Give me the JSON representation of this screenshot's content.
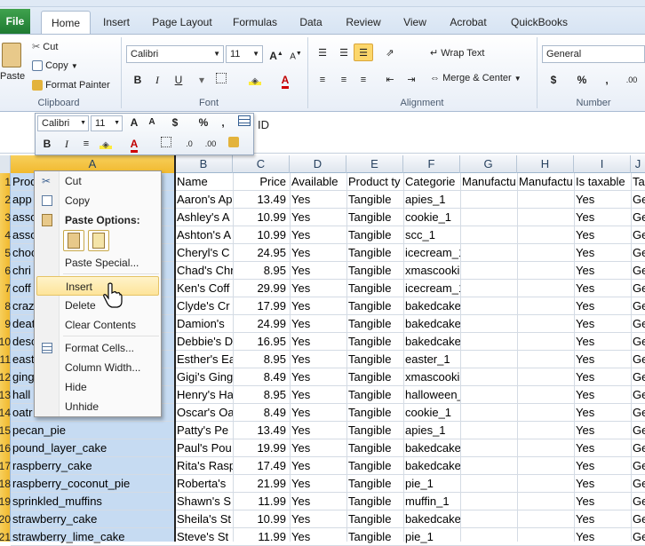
{
  "ribbon": {
    "tabs": [
      "File",
      "Home",
      "Insert",
      "Page Layout",
      "Formulas",
      "Data",
      "Review",
      "View",
      "Acrobat",
      "QuickBooks"
    ],
    "clipboard": {
      "paste": "Paste",
      "cut": "Cut",
      "copy": "Copy",
      "format_painter": "Format Painter",
      "label": "Clipboard"
    },
    "font": {
      "name": "Calibri",
      "size": "11",
      "bold": "B",
      "italic": "I",
      "underline": "U",
      "label": "Font"
    },
    "alignment": {
      "wrap_text": "Wrap Text",
      "merge_center": "Merge & Center",
      "label": "Alignment"
    },
    "number": {
      "format": "General",
      "currency": "$",
      "percent": "%",
      "label": "Number"
    }
  },
  "formula_bar": {
    "content": "ID"
  },
  "mini_toolbar": {
    "font": "Calibri",
    "size": "11",
    "currency": "$",
    "percent": "%",
    "comma": ",",
    "bold": "B",
    "italic": "I"
  },
  "context_menu": {
    "items": [
      "Cut",
      "Copy",
      "Paste Options:",
      "Paste Special...",
      "Insert",
      "Delete",
      "Clear Contents",
      "Format Cells...",
      "Column Width...",
      "Hide",
      "Unhide"
    ],
    "highlighted": "Insert"
  },
  "colors": {
    "accent": "#2a6ebb",
    "selection": "#c6dbf2",
    "row_header": "#f4c542",
    "file_tab": "#2e8b3f",
    "highlight": "#fde49a"
  },
  "columns": [
    "A",
    "B",
    "C",
    "D",
    "E",
    "F",
    "G",
    "H",
    "I",
    "J"
  ],
  "rows": [
    {
      "n": "1",
      "a": "Prod",
      "b": "Name",
      "c": "Price",
      "d": "Available",
      "e": "Product ty",
      "f": "Categorie",
      "g": "Manufactu",
      "h": "Manufactu",
      "i": "Is taxable",
      "j": "Ta"
    },
    {
      "n": "2",
      "a": "app",
      "b": "Aaron's Ap",
      "c": "13.49",
      "d": "Yes",
      "e": "Tangible",
      "f": "apies_1",
      "g": "",
      "h": "",
      "i": "Yes",
      "j": "Ge"
    },
    {
      "n": "3",
      "a": "asso",
      "b": "Ashley's A",
      "c": "10.99",
      "d": "Yes",
      "e": "Tangible",
      "f": "cookie_1",
      "g": "",
      "h": "",
      "i": "Yes",
      "j": "Ge"
    },
    {
      "n": "4",
      "a": "asso",
      "b": "Ashton's A",
      "c": "10.99",
      "d": "Yes",
      "e": "Tangible",
      "f": "scc_1",
      "g": "",
      "h": "",
      "i": "Yes",
      "j": "Ge"
    },
    {
      "n": "5",
      "a": "choc",
      "b": "Cheryl's C",
      "c": "24.95",
      "d": "Yes",
      "e": "Tangible",
      "f": "icecream_1",
      "g": "",
      "h": "",
      "i": "Yes",
      "j": "Ge"
    },
    {
      "n": "6",
      "a": "chri",
      "b": "Chad's Chr",
      "c": "8.95",
      "d": "Yes",
      "e": "Tangible",
      "f": "xmascookie_1",
      "g": "",
      "h": "",
      "i": "Yes",
      "j": "Ge"
    },
    {
      "n": "7",
      "a": "coff",
      "b": "Ken's Coff",
      "c": "29.99",
      "d": "Yes",
      "e": "Tangible",
      "f": "icecream_1",
      "g": "",
      "h": "",
      "i": "Yes",
      "j": "Ge"
    },
    {
      "n": "8",
      "a": "craz",
      "b": "Clyde's Cr",
      "c": "17.99",
      "d": "Yes",
      "e": "Tangible",
      "f": "bakedcake_1",
      "g": "",
      "h": "",
      "i": "Yes",
      "j": "Ge"
    },
    {
      "n": "9",
      "a": "deat",
      "b": "Damion's",
      "c": "24.99",
      "d": "Yes",
      "e": "Tangible",
      "f": "bakedcake_1",
      "g": "",
      "h": "",
      "i": "Yes",
      "j": "Ge"
    },
    {
      "n": "10",
      "a": "desc",
      "b": "Debbie's D",
      "c": "16.95",
      "d": "Yes",
      "e": "Tangible",
      "f": "bakedcake_1",
      "g": "",
      "h": "",
      "i": "Yes",
      "j": "Ge"
    },
    {
      "n": "11",
      "a": "east",
      "b": "Esther's Ea",
      "c": "8.95",
      "d": "Yes",
      "e": "Tangible",
      "f": "easter_1",
      "g": "",
      "h": "",
      "i": "Yes",
      "j": "Ge"
    },
    {
      "n": "12",
      "a": "ging",
      "b": "Gigi's Ging",
      "c": "8.49",
      "d": "Yes",
      "e": "Tangible",
      "f": "xmascookie_1",
      "g": "",
      "h": "",
      "i": "Yes",
      "j": "Ge"
    },
    {
      "n": "13",
      "a": "hall",
      "b": "Henry's Ha",
      "c": "8.95",
      "d": "Yes",
      "e": "Tangible",
      "f": "halloween_1",
      "g": "",
      "h": "",
      "i": "Yes",
      "j": "Ge"
    },
    {
      "n": "14",
      "a": "oatr",
      "b": "Oscar's Oa",
      "c": "8.49",
      "d": "Yes",
      "e": "Tangible",
      "f": "cookie_1",
      "g": "",
      "h": "",
      "i": "Yes",
      "j": "Ge"
    },
    {
      "n": "15",
      "a": "pecan_pie",
      "b": "Patty's Pe",
      "c": "13.49",
      "d": "Yes",
      "e": "Tangible",
      "f": "apies_1",
      "g": "",
      "h": "",
      "i": "Yes",
      "j": "Ge"
    },
    {
      "n": "16",
      "a": "pound_layer_cake",
      "b": "Paul's Pou",
      "c": "19.99",
      "d": "Yes",
      "e": "Tangible",
      "f": "bakedcake_1",
      "g": "",
      "h": "",
      "i": "Yes",
      "j": "Ge"
    },
    {
      "n": "17",
      "a": "raspberry_cake",
      "b": "Rita's Rasp",
      "c": "17.49",
      "d": "Yes",
      "e": "Tangible",
      "f": "bakedcake_1",
      "g": "",
      "h": "",
      "i": "Yes",
      "j": "Ge"
    },
    {
      "n": "18",
      "a": "raspberry_coconut_pie",
      "b": "Roberta's",
      "c": "21.99",
      "d": "Yes",
      "e": "Tangible",
      "f": "pie_1",
      "g": "",
      "h": "",
      "i": "Yes",
      "j": "Ge"
    },
    {
      "n": "19",
      "a": "sprinkled_muffins",
      "b": "Shawn's S",
      "c": "11.99",
      "d": "Yes",
      "e": "Tangible",
      "f": "muffin_1",
      "g": "",
      "h": "",
      "i": "Yes",
      "j": "Ge"
    },
    {
      "n": "20",
      "a": "strawberry_cake",
      "b": "Sheila's St",
      "c": "10.99",
      "d": "Yes",
      "e": "Tangible",
      "f": "bakedcake_1",
      "g": "",
      "h": "",
      "i": "Yes",
      "j": "Ge"
    },
    {
      "n": "21",
      "a": "strawberry_lime_cake",
      "b": "Steve's St",
      "c": "11.99",
      "d": "Yes",
      "e": "Tangible",
      "f": "pie_1",
      "g": "",
      "h": "",
      "i": "Yes",
      "j": "Ge"
    }
  ]
}
